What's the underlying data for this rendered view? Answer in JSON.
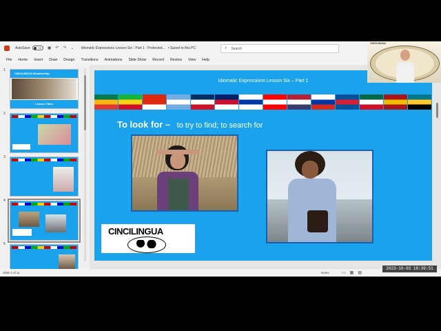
{
  "titlebar": {
    "autosave_label": "AutoSave",
    "autosave_state": "Off",
    "document_title": "Idiomatic Expressions Lesson Six - Part 1 - Protected...",
    "save_status": "• Saved to this PC",
    "search_placeholder": "Search"
  },
  "ribbon": {
    "tabs": [
      "File",
      "Home",
      "Insert",
      "Draw",
      "Design",
      "Transitions",
      "Animations",
      "Slide Show",
      "Record",
      "Review",
      "View",
      "Help"
    ]
  },
  "thumbnails": {
    "numbers": [
      "1",
      "2",
      "3",
      "4",
      "5"
    ],
    "slide1_title": "CINCILINGUA Membership",
    "slide1_caption": "Lesson Video",
    "selected_index": 4
  },
  "slide": {
    "title": "Idiomatic Expressions Lesson Six – Part 1",
    "idiom": "To look for –",
    "definition": "to try to find; to search for",
    "logo_text": "CINCILINGUA",
    "flag_colors": [
      [
        "#007a4d",
        "#ffb612",
        "#de3831"
      ],
      [
        "#14b53a",
        "#fcd116",
        "#ce1126"
      ],
      [
        "#de2910",
        "#de2910",
        "#ffffff"
      ],
      [
        "#74acdf",
        "#ffffff",
        "#74acdf"
      ],
      [
        "#002d62",
        "#ffffff",
        "#ce1126"
      ],
      [
        "#012169",
        "#c8102e",
        "#ffffff"
      ],
      [
        "#ffffff",
        "#0038a8",
        "#ffffff"
      ],
      [
        "#ff0000",
        "#ffffff",
        "#ff0000"
      ],
      [
        "#b22234",
        "#ffffff",
        "#3c3b6e"
      ],
      [
        "#ffffff",
        "#0039a6",
        "#d52b1e"
      ],
      [
        "#02529c",
        "#dc1e35",
        "#02529c"
      ],
      [
        "#006847",
        "#ffffff",
        "#ce1126"
      ],
      [
        "#aa151b",
        "#f1bf00",
        "#aa151b"
      ],
      [
        "#00778b",
        "#ffc72c",
        "#000000"
      ]
    ]
  },
  "statusbar": {
    "slide_indicator": "Slide 4 of 11",
    "notes_label": "Notes"
  },
  "overlay": {
    "timestamp": "2023-10-03 18:39:51",
    "webcam_label": "CINCILINGUA"
  }
}
